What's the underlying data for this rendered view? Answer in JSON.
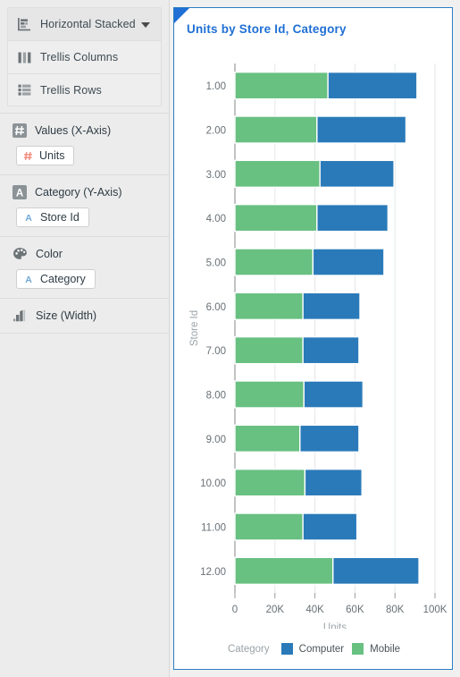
{
  "sidebar": {
    "chart_type": {
      "label": "Horizontal Stacked",
      "icon": "horizontal-stacked-icon",
      "caret": "chevron-down-icon"
    },
    "rows": [
      {
        "label": "Trellis Columns",
        "icon": "trellis-columns-icon"
      },
      {
        "label": "Trellis Rows",
        "icon": "trellis-rows-icon"
      }
    ],
    "shelves": [
      {
        "label": "Values (X-Axis)",
        "icon": "measure-hash-icon",
        "chips": [
          {
            "label": "Units",
            "icon": "measure-hash-icon"
          }
        ]
      },
      {
        "label": "Category (Y-Axis)",
        "icon": "attribute-a-icon",
        "chips": [
          {
            "label": "Store Id",
            "icon": "attribute-a-icon"
          }
        ]
      },
      {
        "label": "Color",
        "icon": "palette-icon",
        "chips": [
          {
            "label": "Category",
            "icon": "attribute-a-icon"
          }
        ]
      },
      {
        "label": "Size (Width)",
        "icon": "size-width-icon",
        "chips": []
      }
    ]
  },
  "chart_panel": {
    "title": "Units by Store Id, Category",
    "corner_marker": "blue-corner-triangle",
    "border_color": "#2b7dc4",
    "title_color": "#1f6fd4"
  },
  "chart_data": {
    "type": "bar",
    "orientation": "horizontal",
    "stacked": true,
    "title": "Units by Store Id, Category",
    "xlabel": "Units",
    "ylabel": "Store Id",
    "xlim": [
      0,
      100000
    ],
    "xticks": [
      0,
      20000,
      40000,
      60000,
      80000,
      100000
    ],
    "xticklabels": [
      "0",
      "20K",
      "40K",
      "60K",
      "80K",
      "100K"
    ],
    "categories": [
      "1.00",
      "2.00",
      "3.00",
      "4.00",
      "5.00",
      "6.00",
      "7.00",
      "8.00",
      "9.00",
      "10.00",
      "11.00",
      "12.00"
    ],
    "grid": true,
    "legend": {
      "title": "Category",
      "position": "bottom"
    },
    "series": [
      {
        "name": "Mobile",
        "color": "#68c081",
        "values": [
          46500,
          41000,
          42500,
          41000,
          39000,
          34000,
          34000,
          34500,
          32500,
          35000,
          34000,
          49000
        ]
      },
      {
        "name": "Computer",
        "color": "#2a7ab9",
        "values": [
          44500,
          44500,
          37000,
          35500,
          35500,
          28500,
          28000,
          29500,
          29500,
          28500,
          27000,
          43000
        ]
      }
    ],
    "legend_order": [
      "Computer",
      "Mobile"
    ]
  }
}
